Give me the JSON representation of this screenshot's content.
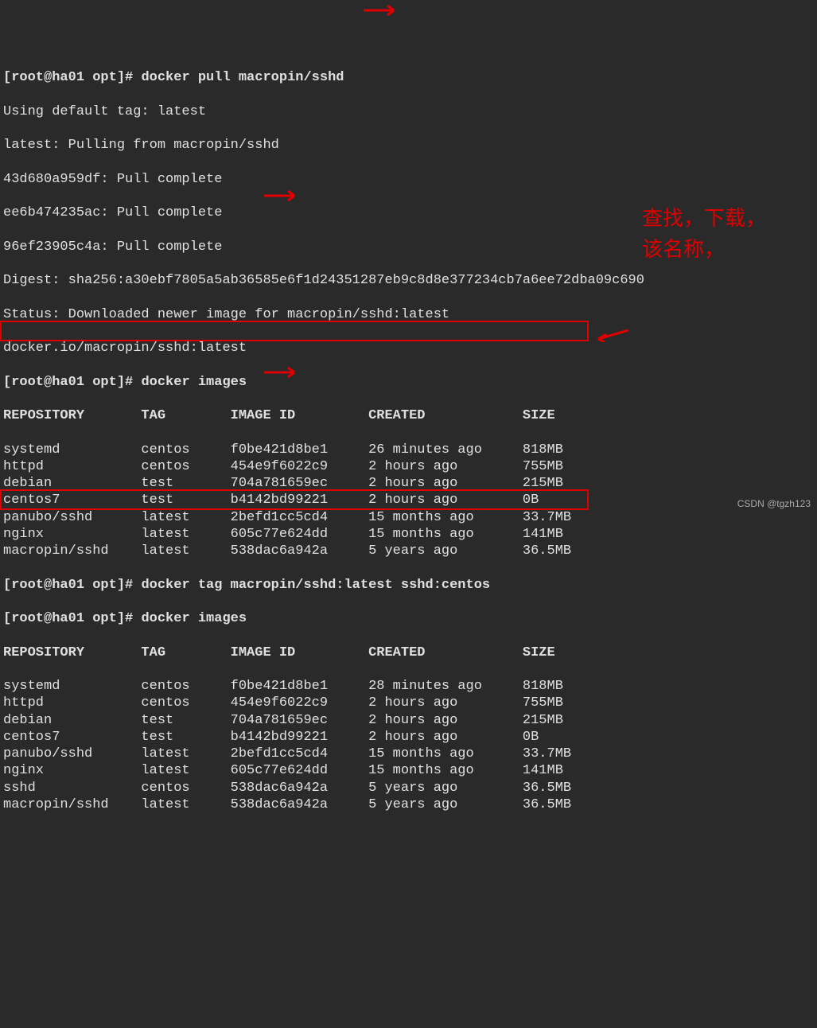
{
  "prompt1": "[root@ha01 opt]# ",
  "cmd1": "docker pull macropin/sshd",
  "pull_output": [
    "Using default tag: latest",
    "latest: Pulling from macropin/sshd",
    "43d680a959df: Pull complete",
    "ee6b474235ac: Pull complete",
    "96ef23905c4a: Pull complete",
    "Digest: sha256:a30ebf7805a5ab36585e6f1d24351287eb9c8d8e377234cb7a6ee72dba09c690",
    "Status: Downloaded newer image for macropin/sshd:latest",
    "docker.io/macropin/sshd:latest"
  ],
  "prompt2": "[root@ha01 opt]# ",
  "cmd2": "docker images",
  "images_header": {
    "repo": "REPOSITORY",
    "tag": "TAG",
    "id": "IMAGE ID",
    "created": "CREATED",
    "size": "SIZE"
  },
  "images1": [
    {
      "repo": "systemd",
      "tag": "centos",
      "id": "f0be421d8be1",
      "created": "26 minutes ago",
      "size": "818MB"
    },
    {
      "repo": "httpd",
      "tag": "centos",
      "id": "454e9f6022c9",
      "created": "2 hours ago",
      "size": "755MB"
    },
    {
      "repo": "debian",
      "tag": "test",
      "id": "704a781659ec",
      "created": "2 hours ago",
      "size": "215MB"
    },
    {
      "repo": "centos7",
      "tag": "test",
      "id": "b4142bd99221",
      "created": "2 hours ago",
      "size": "0B"
    },
    {
      "repo": "panubo/sshd",
      "tag": "latest",
      "id": "2befd1cc5cd4",
      "created": "15 months ago",
      "size": "33.7MB"
    },
    {
      "repo": "nginx",
      "tag": "latest",
      "id": "605c77e624dd",
      "created": "15 months ago",
      "size": "141MB"
    },
    {
      "repo": "macropin/sshd",
      "tag": "latest",
      "id": "538dac6a942a",
      "created": "5 years ago",
      "size": "36.5MB"
    }
  ],
  "prompt3": "[root@ha01 opt]# ",
  "cmd3": "docker tag macropin/sshd:latest sshd:centos",
  "prompt4": "[root@ha01 opt]# ",
  "cmd4": "docker images",
  "images2": [
    {
      "repo": "systemd",
      "tag": "centos",
      "id": "f0be421d8be1",
      "created": "28 minutes ago",
      "size": "818MB"
    },
    {
      "repo": "httpd",
      "tag": "centos",
      "id": "454e9f6022c9",
      "created": "2 hours ago",
      "size": "755MB"
    },
    {
      "repo": "debian",
      "tag": "test",
      "id": "704a781659ec",
      "created": "2 hours ago",
      "size": "215MB"
    },
    {
      "repo": "centos7",
      "tag": "test",
      "id": "b4142bd99221",
      "created": "2 hours ago",
      "size": "0B"
    },
    {
      "repo": "panubo/sshd",
      "tag": "latest",
      "id": "2befd1cc5cd4",
      "created": "15 months ago",
      "size": "33.7MB"
    },
    {
      "repo": "nginx",
      "tag": "latest",
      "id": "605c77e624dd",
      "created": "15 months ago",
      "size": "141MB"
    },
    {
      "repo": "sshd",
      "tag": "centos",
      "id": "538dac6a942a",
      "created": "5 years ago",
      "size": "36.5MB"
    },
    {
      "repo": "macropin/sshd",
      "tag": "latest",
      "id": "538dac6a942a",
      "created": "5 years ago",
      "size": "36.5MB"
    }
  ],
  "annotation": "查找，下载，该名称，",
  "watermark": "CSDN @tgzh123"
}
